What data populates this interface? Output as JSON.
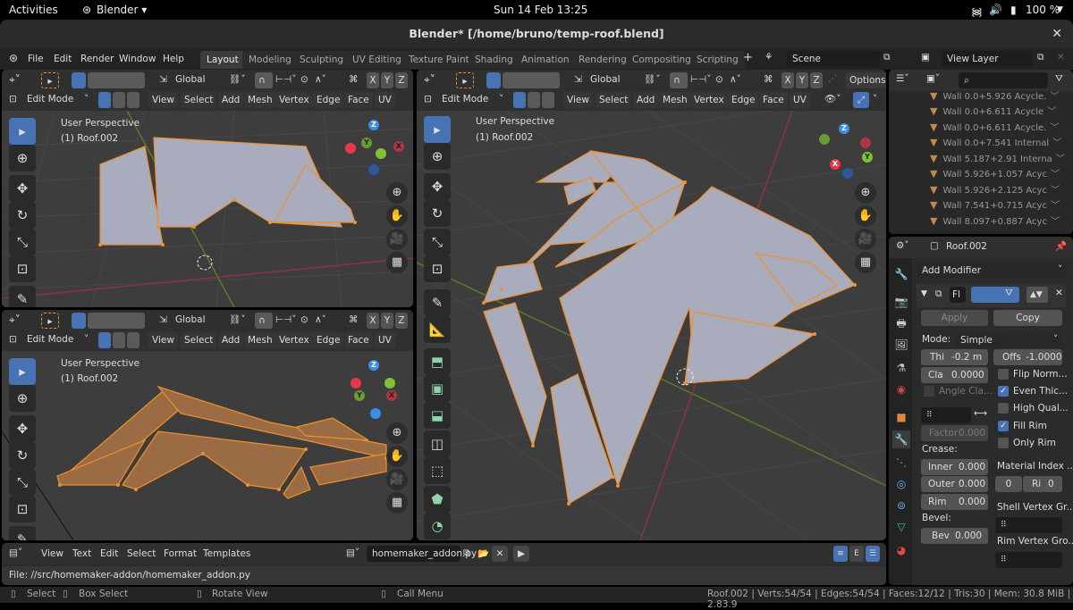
{
  "gnome": {
    "activities": "Activities",
    "app_menu": "Blender ▾",
    "clock": "Sun 14 Feb  13:25",
    "battery": "100 %"
  },
  "window": {
    "title": "Blender* [/home/bruno/temp-roof.blend]",
    "close": "✕"
  },
  "menu": [
    "File",
    "Edit",
    "Render",
    "Window",
    "Help"
  ],
  "workspaces": [
    "Layout",
    "Modeling",
    "Sculpting",
    "UV Editing",
    "Texture Paint",
    "Shading",
    "Animation",
    "Rendering",
    "Compositing",
    "Scripting"
  ],
  "workspace_add": "+",
  "scene": {
    "value": "Scene"
  },
  "view_layer": {
    "value": "View Layer"
  },
  "viewport_header": {
    "orientation": "Global",
    "axes": [
      "X",
      "Y",
      "Z"
    ],
    "mode": "Edit Mode",
    "menus": [
      "View",
      "Select",
      "Add",
      "Mesh",
      "Vertex",
      "Edge",
      "Face",
      "UV"
    ],
    "options": "Options"
  },
  "viewports": [
    {
      "view": "User Perspective",
      "object": "(1) Roof.002"
    },
    {
      "view": "User Perspective",
      "object": "(1) Roof.002"
    },
    {
      "view": "User Perspective",
      "object": "(1) Roof.002"
    }
  ],
  "outliner": {
    "search_placeholder": "",
    "items": [
      "Wall 0.0+5.926 Acycle.",
      "Wall 0.0+6.611 Acycle",
      "Wall 0.0+6.611 Acycle.",
      "Wall 0.0+7.541 Internal",
      "Wall 5.187+2.91 Interna",
      "Wall 5.926+1.057 Acyc",
      "Wall 5.926+2.125 Acyc",
      "Wall 7.541+0.715 Acyc",
      "Wall 8.097+0.887 Acyc"
    ]
  },
  "properties": {
    "object_name": "Roof.002",
    "add_modifier": "Add Modifier",
    "modifier_name": "Fl",
    "apply": "Apply",
    "copy": "Copy",
    "mode_label": "Mode:",
    "mode_value": "Simple",
    "thickness_label": "Thi",
    "thickness_value": "-0.2 m",
    "offset_label": "Offs",
    "offset_value": "-1.0000",
    "clamp_label": "Cla",
    "clamp_value": "0.0000",
    "angle_clamp": "Angle Cla...",
    "factor_label": "Factor",
    "factor_value": "0.000",
    "flip_normals": {
      "label": "Flip Norm...",
      "checked": false
    },
    "even_thickness": {
      "label": "Even Thic...",
      "checked": true
    },
    "high_quality": {
      "label": "High Qual...",
      "checked": false
    },
    "fill_rim": {
      "label": "Fill Rim",
      "checked": true
    },
    "only_rim": {
      "label": "Only Rim",
      "checked": false
    },
    "crease_label": "Crease:",
    "inner_label": "Inner",
    "inner_value": "0.000",
    "outer_label": "Outer",
    "outer_value": "0.000",
    "rim_label": "Rim",
    "rim_value": "0.000",
    "material_index_label": "Material Index ...",
    "mat_index_value": "0",
    "mat_rim_label": "Ri",
    "mat_rim_value": "0",
    "bevel_label": "Bevel:",
    "bevel_field_label": "Bev",
    "bevel_value": "0.000",
    "shell_vg_label": "Shell Vertex Gr...",
    "rim_vg_label": "Rim Vertex Gro..."
  },
  "text_editor": {
    "menus": [
      "View",
      "Text",
      "Edit",
      "Select",
      "Format",
      "Templates"
    ],
    "filename": "homemaker_addon.py",
    "footer": "File: //src/homemaker-addon/homemaker_addon.py"
  },
  "status": {
    "select": "Select",
    "box_select": "Box Select",
    "rotate_view": "Rotate View",
    "call_menu": "Call Menu",
    "stats": "Roof.002 | Verts:54/54 | Edges:54/54 | Faces:12/12 | Tris:30 | Mem: 30.8 MiB | 2.83.9"
  },
  "colors": {
    "accent_blue": "#4772b3",
    "selection_orange": "#f0902a",
    "axis_x": "#e8374c",
    "axis_y": "#80c332",
    "axis_z": "#3a8ee6"
  }
}
